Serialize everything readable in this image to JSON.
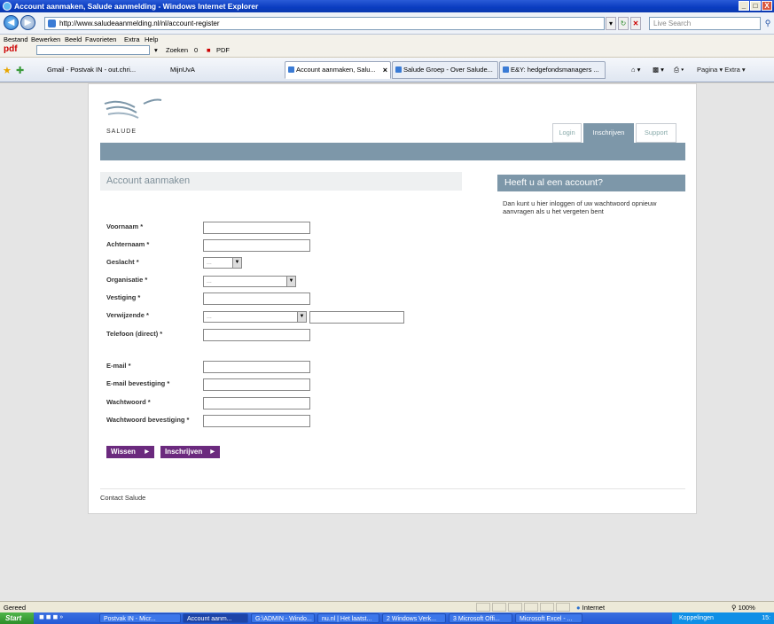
{
  "window": {
    "title": "Account aanmaken, Salude aanmelding - Windows Internet Explorer",
    "controls": [
      "_",
      "□",
      "X"
    ]
  },
  "address": {
    "url": "http://www.saludeaanmelding.nl/nl/account-register",
    "search_placeholder": "Live Search"
  },
  "menu": {
    "items": [
      "Bestand",
      "Bewerken",
      "Beeld",
      "Favorieten",
      "Extra",
      "Help"
    ]
  },
  "pdf_toolbar": {
    "logo": "pdf",
    "search_label": "Zoeken",
    "count": "0",
    "pdf_label": "PDF"
  },
  "favorites": {
    "links": [
      "Gmail - Postvak IN - out.chri...",
      "MijnUvA"
    ]
  },
  "tabs": [
    {
      "label": "Account aanmaken, Salu...",
      "active": true
    },
    {
      "label": "Salude Groep - Over Salude...",
      "active": false
    },
    {
      "label": "E&Y: hedgefondsmanagers ...",
      "active": false
    }
  ],
  "command_bar": {
    "text": "Pagina ▾   Extra ▾"
  },
  "site": {
    "brand": "SALUDE",
    "nav_tabs": [
      {
        "label": "Login",
        "active": false
      },
      {
        "label": "Inschrijven",
        "active": true
      },
      {
        "label": "Support",
        "active": false
      }
    ],
    "section_title": "Account aanmaken",
    "side_title": "Heeft u al een account?",
    "side_text": "Dan kunt u hier inloggen of uw wachtwoord opnieuw aanvragen als u het vergeten bent",
    "form": {
      "voornaam": "Voornaam *",
      "achternaam": "Achternaam *",
      "geslacht": "Geslacht *",
      "geslacht_value": "...",
      "organisatie": "Organisatie *",
      "organisatie_value": "...",
      "vestiging": "Vestiging *",
      "verwijzende": "Verwijzende *",
      "verwijzende_value": "...",
      "telefoon": "Telefoon (direct) *",
      "email": "E-mail *",
      "email_bevestiging": "E-mail bevestiging *",
      "wachtwoord": "Wachtwoord *",
      "wachtwoord_bevestiging": "Wachtwoord bevestiging *"
    },
    "buttons": {
      "clear": "Wissen",
      "submit": "Inschrijven"
    },
    "footer_link": "Contact Salude"
  },
  "status": {
    "left": "Gereed",
    "zone": "Internet",
    "zoom": "100%"
  },
  "taskbar": {
    "start": "Start",
    "tasks": [
      {
        "label": "Postvak IN - Micr...",
        "active": false
      },
      {
        "label": "Account aanm...",
        "active": true
      },
      {
        "label": "G:\\ADMIN - Windo...",
        "active": false
      },
      {
        "label": "nu.nl | Het laatst...",
        "active": false
      },
      {
        "label": "2 Windows Verk...",
        "active": false
      },
      {
        "label": "3 Microsoft Offi...",
        "active": false
      },
      {
        "label": "Microsoft Excel - ...",
        "active": false
      }
    ],
    "tray_label": "Koppelingen",
    "clock": "15:"
  },
  "colors": {
    "accent": "#7d97a9",
    "button": "#6b2a7e",
    "titlebar": "#0a3cc0"
  }
}
